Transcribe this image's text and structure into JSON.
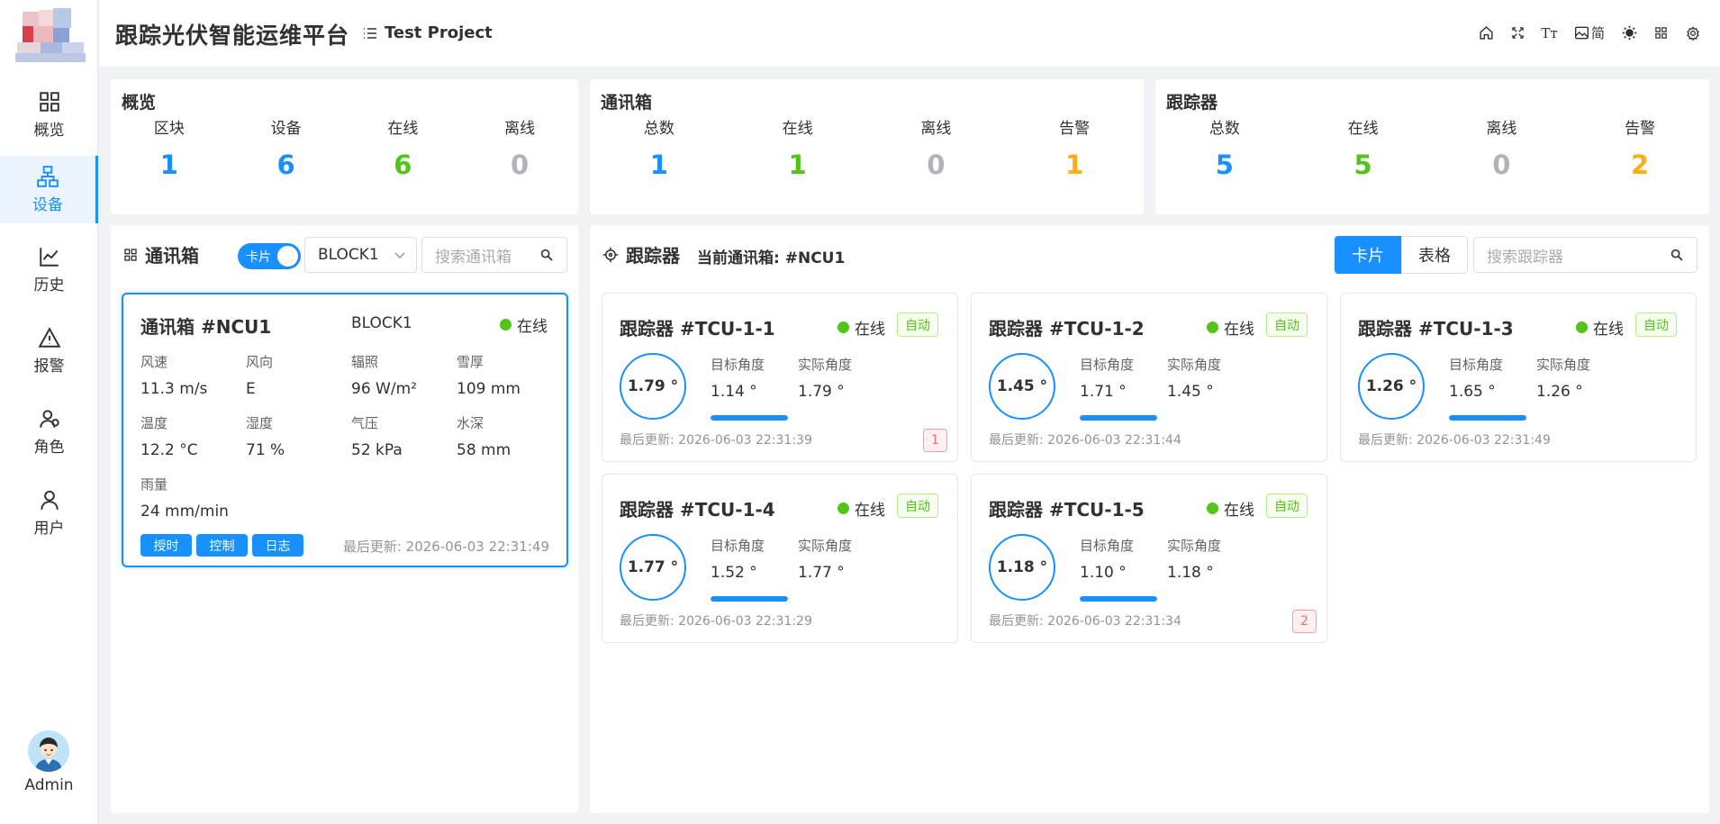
{
  "header": {
    "app_title": "跟踪光伏智能运维平台",
    "project": "Test Project",
    "icons": [
      "home-icon",
      "fullscreen-icon",
      "font-size-icon",
      "image-icon",
      "theme-icon",
      "layout-icon",
      "settings-icon"
    ],
    "lang_label": "简"
  },
  "sidebar": {
    "items": [
      {
        "label": "概览",
        "icon": "dashboard-icon"
      },
      {
        "label": "设备",
        "icon": "device-icon"
      },
      {
        "label": "历史",
        "icon": "history-icon"
      },
      {
        "label": "报警",
        "icon": "alarm-icon"
      },
      {
        "label": "角色",
        "icon": "role-icon"
      },
      {
        "label": "用户",
        "icon": "user-icon"
      }
    ],
    "active": "设备",
    "user_name": "Admin"
  },
  "overview": {
    "title": "概览",
    "stats": [
      {
        "label": "区块",
        "value": "1",
        "color": "#1890ff"
      },
      {
        "label": "设备",
        "value": "6",
        "color": "#1890ff"
      },
      {
        "label": "在线",
        "value": "6",
        "color": "#52c41a"
      },
      {
        "label": "离线",
        "value": "0",
        "color": "#b0b3b8"
      }
    ]
  },
  "comm_stats": {
    "title": "通讯箱",
    "stats": [
      {
        "label": "总数",
        "value": "1",
        "color": "#1890ff"
      },
      {
        "label": "在线",
        "value": "1",
        "color": "#52c41a"
      },
      {
        "label": "离线",
        "value": "0",
        "color": "#b0b3b8"
      },
      {
        "label": "告警",
        "value": "1",
        "color": "#faad14"
      }
    ]
  },
  "tracker_stats": {
    "title": "跟踪器",
    "stats": [
      {
        "label": "总数",
        "value": "5",
        "color": "#1890ff"
      },
      {
        "label": "在线",
        "value": "5",
        "color": "#52c41a"
      },
      {
        "label": "离线",
        "value": "0",
        "color": "#b0b3b8"
      },
      {
        "label": "告警",
        "value": "2",
        "color": "#faad14"
      }
    ]
  },
  "comm_panel": {
    "title": "通讯箱",
    "switch_label": "卡片",
    "block_select": "BLOCK1",
    "search_placeholder": "搜索通讯箱",
    "ncu": {
      "name": "通讯箱 #NCU1",
      "block": "BLOCK1",
      "status": "在线",
      "fields": [
        {
          "k": "风速",
          "v": "11.3 m/s"
        },
        {
          "k": "风向",
          "v": "E"
        },
        {
          "k": "辐照",
          "v": "96 W/m²"
        },
        {
          "k": "雪厚",
          "v": "109 mm"
        },
        {
          "k": "温度",
          "v": "12.2 °C"
        },
        {
          "k": "湿度",
          "v": "71 %"
        },
        {
          "k": "气压",
          "v": "52 kPa"
        },
        {
          "k": "水深",
          "v": "58 mm"
        },
        {
          "k": "雨量",
          "v": "24 mm/min"
        }
      ],
      "buttons": [
        "授时",
        "控制",
        "日志"
      ],
      "updated": "最后更新: 2026-06-03 22:31:49"
    }
  },
  "tracker_panel": {
    "title": "跟踪器",
    "current": "当前通讯箱: #NCU1",
    "view_card": "卡片",
    "view_table": "表格",
    "search_placeholder": "搜索跟踪器",
    "target_label": "目标角度",
    "actual_label": "实际角度",
    "trackers": [
      {
        "name": "跟踪器 #TCU-1-1",
        "status": "在线",
        "mode": "自动",
        "angle": "1.79 °",
        "target": "1.14 °",
        "actual": "1.79 °",
        "progress": 1.0,
        "updated": "最后更新: 2026-06-03 22:31:39",
        "alarm": "1"
      },
      {
        "name": "跟踪器 #TCU-1-2",
        "status": "在线",
        "mode": "自动",
        "angle": "1.45 °",
        "target": "1.71 °",
        "actual": "1.45 °",
        "progress": 1.0,
        "updated": "最后更新: 2026-06-03 22:31:44",
        "alarm": ""
      },
      {
        "name": "跟踪器 #TCU-1-3",
        "status": "在线",
        "mode": "自动",
        "angle": "1.26 °",
        "target": "1.65 °",
        "actual": "1.26 °",
        "progress": 1.0,
        "updated": "最后更新: 2026-06-03 22:31:49",
        "alarm": ""
      },
      {
        "name": "跟踪器 #TCU-1-4",
        "status": "在线",
        "mode": "自动",
        "angle": "1.77 °",
        "target": "1.52 °",
        "actual": "1.77 °",
        "progress": 1.0,
        "updated": "最后更新: 2026-06-03 22:31:29",
        "alarm": ""
      },
      {
        "name": "跟踪器 #TCU-1-5",
        "status": "在线",
        "mode": "自动",
        "angle": "1.18 °",
        "target": "1.10 °",
        "actual": "1.18 °",
        "progress": 1.0,
        "updated": "最后更新: 2026-06-03 22:31:34",
        "alarm": "2"
      }
    ]
  }
}
